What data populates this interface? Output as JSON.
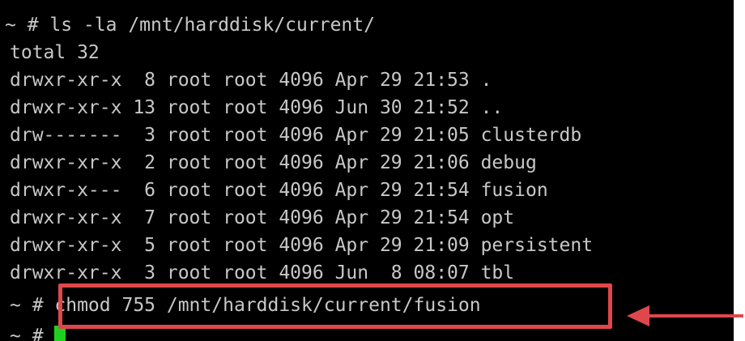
{
  "terminal": {
    "lines": [
      "~ # ls -la /mnt/harddisk/current/",
      "total 32",
      "drwxr-xr-x  8 root root 4096 Apr 29 21:53 .",
      "drwxr-xr-x 13 root root 4096 Jun 30 21:52 ..",
      "drw-------  3 root root 4096 Apr 29 21:05 clusterdb",
      "drwxr-xr-x  2 root root 4096 Apr 29 21:06 debug",
      "drwxr-x---  6 root root 4096 Apr 29 21:54 fusion",
      "drwxr-xr-x  7 root root 4096 Apr 29 21:54 opt",
      "drwxr-xr-x  5 root root 4096 Apr 29 21:09 persistent",
      "drwxr-xr-x  3 root root 4096 Jun  8 08:07 tbl",
      "~ # chmod 755 /mnt/harddisk/current/fusion",
      "~ # "
    ]
  },
  "colors": {
    "background": "#000000",
    "text": "#c8c8c8",
    "cursor": "#1fd11f",
    "highlight": "#e0474c"
  },
  "annotations": {
    "highlight_box": "red-rectangle",
    "pointer": "red-arrow-icon"
  }
}
